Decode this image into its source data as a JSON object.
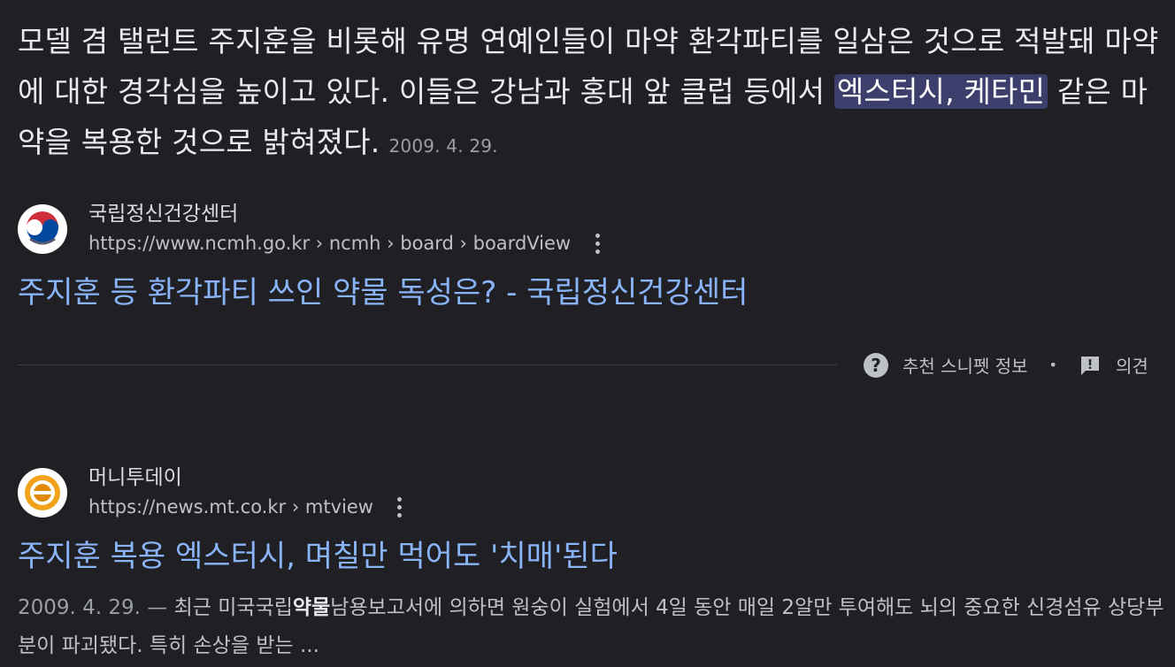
{
  "featured_snippet": {
    "text_before": "모델 겸 탤런트 주지훈을 비롯해 유명 연예인들이 마약 환각파티를 일삼은 것으로 적발돼 마약에 대한 경각심을 높이고 있다. 이들은 강남과 홍대 앞 클럽 등에서 ",
    "highlight": "엑스터시, 케타민",
    "text_after": " 같은 마약을 복용한 것으로 밝혀졌다.",
    "date": "2009. 4. 29."
  },
  "result1": {
    "source_name": "국립정신건강센터",
    "url": "https://www.ncmh.go.kr › ncmh › board › boardView",
    "title": "주지훈 등 환각파티 쓰인 약물 독성은? - 국립정신건강센터",
    "favicon": "korean-government-emblem-icon"
  },
  "footer": {
    "about_label": "추천 스니펫 정보",
    "separator": "•",
    "feedback_label": "의견"
  },
  "result2": {
    "source_name": "머니투데이",
    "url": "https://news.mt.co.kr › mtview",
    "title": "주지훈 복용 엑스터시, 며칠만 먹어도 '치매'된다",
    "favicon": "money-today-logo-icon",
    "snippet_date": "2009. 4. 29. —",
    "snippet_part1": " 최근 미국국립",
    "snippet_bold": "약물",
    "snippet_part2": "남용보고서에 의하면 원숭이 실험에서 4일 동안 매일 2알만 투여해도 뇌의 중요한 신경섬유 상당부분이 파괴됐다. 특히 손상을 받는 ..."
  },
  "colors": {
    "background": "#1f1f24",
    "link": "#8ab4f8",
    "highlight": "#3c3e6b",
    "text": "#e8eaed",
    "muted": "#9aa0a6"
  }
}
